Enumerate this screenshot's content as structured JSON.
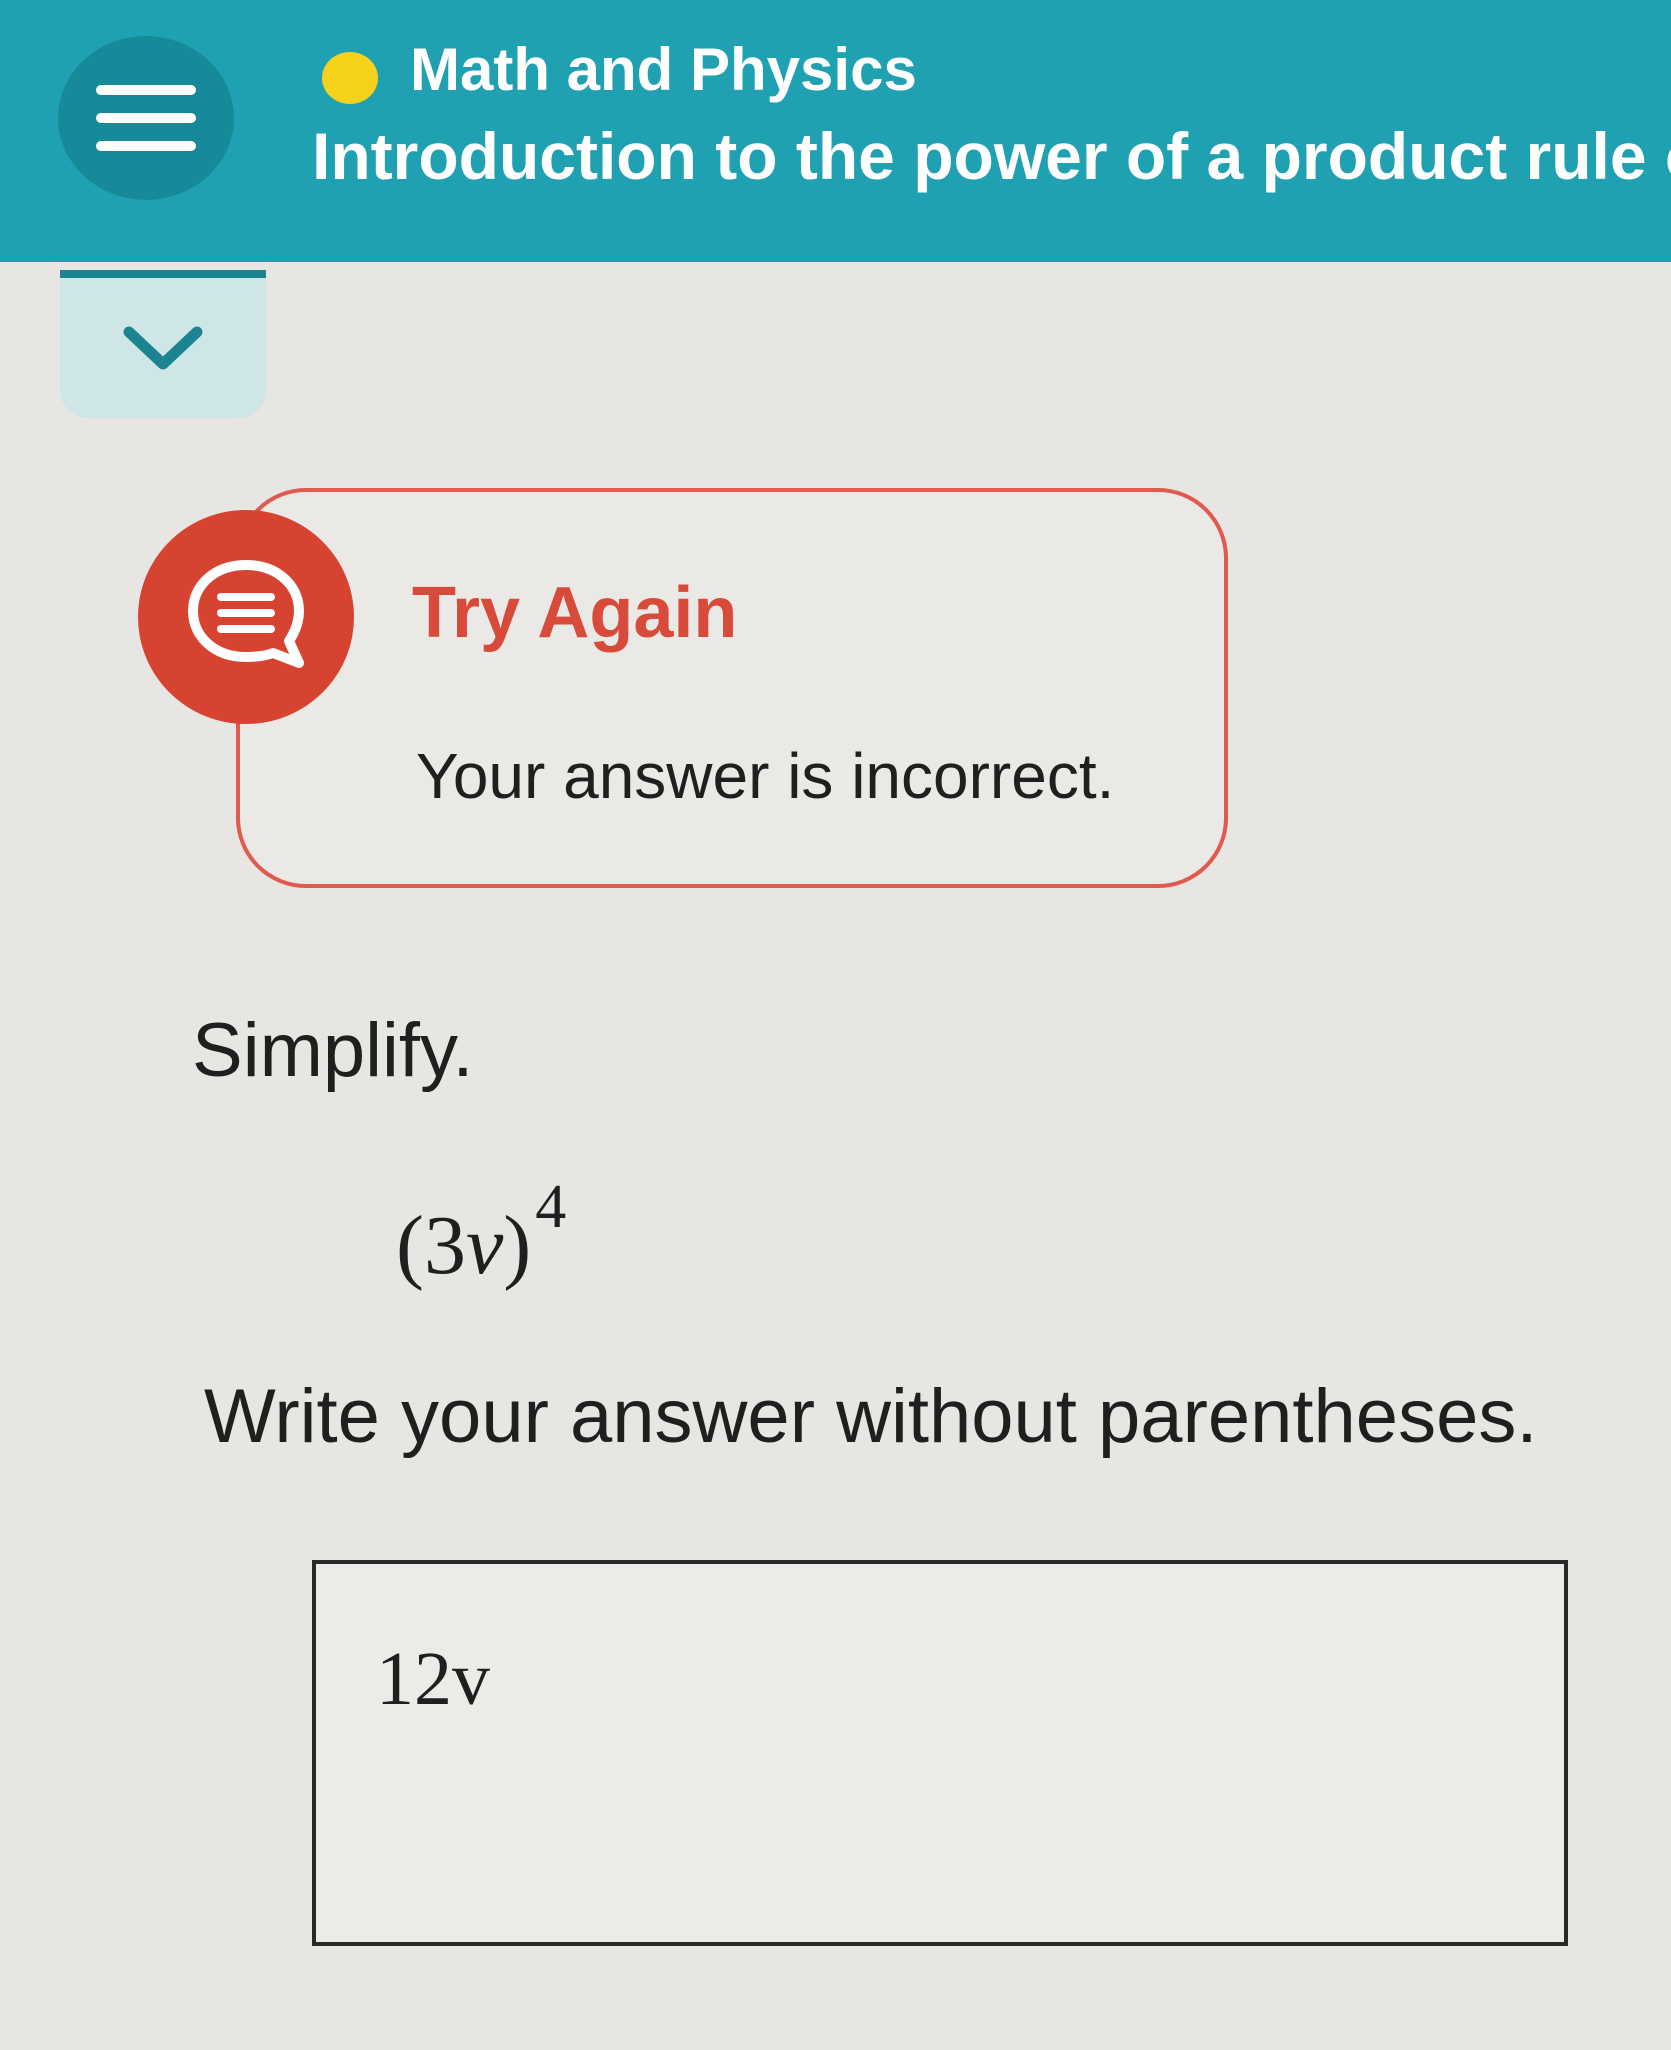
{
  "header": {
    "course_name": "Math and Physics",
    "lesson_title": "Introduction to the power of a product rule of"
  },
  "icons": {
    "menu": "hamburger-menu-icon",
    "course_status": "yellow-dot-icon",
    "collapse": "chevron-down-icon",
    "feedback": "speech-bubble-icon"
  },
  "feedback": {
    "title": "Try Again",
    "message": "Your answer is incorrect."
  },
  "question": {
    "instruction": "Simplify.",
    "expression": {
      "open_paren": "(",
      "coefficient": "3",
      "variable": "v",
      "close_paren": ")",
      "exponent": "4"
    },
    "instruction_2": "Write your answer without parentheses."
  },
  "answer": {
    "value": "12v"
  },
  "colors": {
    "header_bg": "#1fa1b2",
    "status_dot": "#f4d21c",
    "error_red": "#d84a3a",
    "page_bg": "#e8e6e2"
  }
}
